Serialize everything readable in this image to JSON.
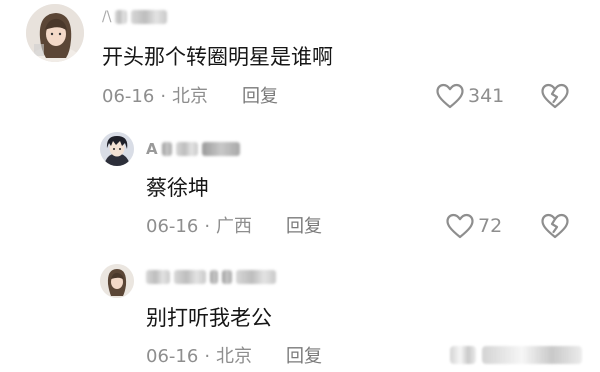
{
  "comments": [
    {
      "text": "开头那个转圈明星是谁啊",
      "date": "06-16",
      "separator": "·",
      "location": "北京",
      "reply_label": "回复",
      "likes": "341",
      "avatar_icon": "user-avatar-girl",
      "username_visible": "/\\"
    },
    {
      "text": "蔡徐坤",
      "date": "06-16",
      "separator": "·",
      "location": "广西",
      "reply_label": "回复",
      "likes": "72",
      "avatar_icon": "user-avatar-anime-boy",
      "username_visible": "A"
    },
    {
      "text": "别打听我老公",
      "date": "06-16",
      "separator": "·",
      "location": "北京",
      "reply_label": "回复",
      "avatar_icon": "user-avatar-girl"
    }
  ],
  "icons": {
    "like": "heart-outline-icon",
    "dislike": "broken-heart-icon"
  },
  "colors": {
    "text": "#161616",
    "meta": "#8e8e8e",
    "background": "#ffffff"
  }
}
